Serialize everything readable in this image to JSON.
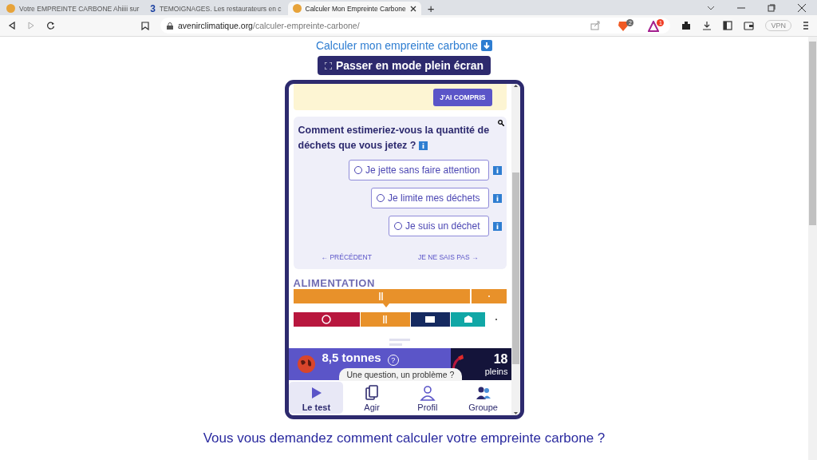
{
  "browser": {
    "tabs": [
      {
        "title": "Votre EMPREINTE CARBONE Ahiiii sur",
        "selected": false
      },
      {
        "title": "TEMOIGNAGES. Les restaurateurs en c",
        "selected": false,
        "logo": "3"
      },
      {
        "title": "Calculer Mon Empreinte Carbone",
        "selected": true
      }
    ],
    "new_tab": "+",
    "url_host": "avenirclimatique.org",
    "url_path": "/calculer-empreinte-carbone/",
    "shield_count": "2",
    "alert_count": "1",
    "vpn": "VPN"
  },
  "page": {
    "link": "Calculer mon empreinte carbone",
    "fullscreen_button": "Passer en mode plein écran",
    "heading": "Vous vous demandez comment calculer votre empreinte carbone ?"
  },
  "app": {
    "banner_button": "J'AI COMPRIS",
    "question": "Comment estimeriez-vous la quantité de déchets que vous jetez ?",
    "options": [
      {
        "label": "Je jette sans faire attention",
        "selected": false
      },
      {
        "label": "Je limite mes déchets",
        "selected": false
      },
      {
        "label": "Je suis un déchet",
        "selected": false
      }
    ],
    "previous": "← PRÉCÉDENT",
    "skip": "JE NE SAIS PAS →",
    "category": "ALIMENTATION",
    "footprint": "8,5 tonnes",
    "help": "?",
    "fuel_count": "18",
    "fuel_unit": "pleins",
    "tooltip": "Une question, un problème ?",
    "nav": [
      {
        "label": "Le test",
        "selected": true
      },
      {
        "label": "Agir",
        "selected": false
      },
      {
        "label": "Profil",
        "selected": false
      },
      {
        "label": "Groupe",
        "selected": false
      }
    ]
  }
}
